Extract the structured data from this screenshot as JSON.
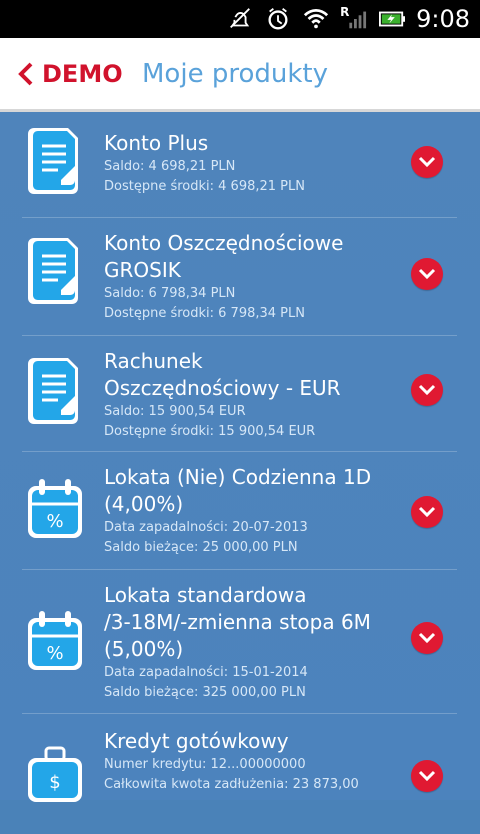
{
  "status": {
    "time": "9:08",
    "network_letter": "R"
  },
  "header": {
    "back_label": "DEMO",
    "title": "Moje produkty"
  },
  "colors": {
    "accent_red": "#d1122c",
    "title_blue": "#5aa2da",
    "list_bg": "#4a82b8"
  },
  "items": [
    {
      "name1": "Konto Plus",
      "name2": "",
      "line1": "Saldo: 4 698,21 PLN",
      "line2": "Dostępne środki: 4 698,21 PLN",
      "icon": "document-icon"
    },
    {
      "name1": "Konto Oszczędnościowe",
      "name2": "GROSIK",
      "line1": "Saldo: 6 798,34 PLN",
      "line2": "Dostępne środki: 6 798,34 PLN",
      "icon": "document-icon"
    },
    {
      "name1": "Rachunek",
      "name2": "Oszczędnościowy - EUR",
      "line1": "Saldo: 15 900,54 EUR",
      "line2": "Dostępne środki: 15 900,54 EUR",
      "icon": "document-icon"
    },
    {
      "name1": "Lokata (Nie) Codzienna 1D",
      "name2": "(4,00%)",
      "line1": "Data zapadalności: 20-07-2013",
      "line2": "Saldo bieżące: 25 000,00 PLN",
      "icon": "calendar-percent-icon"
    },
    {
      "name1": "Lokata standardowa",
      "name2": "/3-18M/-zmienna stopa 6M",
      "name3": "(5,00%)",
      "line1": "Data zapadalności: 15-01-2014",
      "line2": "Saldo bieżące: 325 000,00 PLN",
      "icon": "calendar-percent-icon"
    },
    {
      "name1": "Kredyt gotówkowy",
      "name2": "",
      "line1": "Numer kredytu: 12...00000000",
      "line2": "Całkowita kwota zadłużenia: 23 873,00",
      "icon": "briefcase-dollar-icon"
    }
  ]
}
